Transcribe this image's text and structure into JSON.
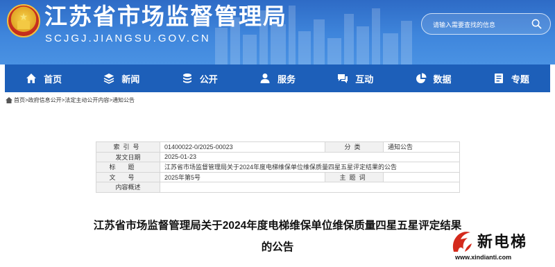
{
  "header": {
    "site_title": "江苏省市场监督管理局",
    "site_url": "SCJGJ.JIANGSU.GOV.CN",
    "search_placeholder": "请输入需要查找的信息"
  },
  "nav": {
    "items": [
      {
        "label": "首页",
        "icon": "home-icon"
      },
      {
        "label": "新闻",
        "icon": "news-icon"
      },
      {
        "label": "公开",
        "icon": "disclosure-icon"
      },
      {
        "label": "服务",
        "icon": "service-icon"
      },
      {
        "label": "互动",
        "icon": "interaction-icon"
      },
      {
        "label": "数据",
        "icon": "data-icon"
      },
      {
        "label": "专题",
        "icon": "topic-icon"
      }
    ]
  },
  "breadcrumb": {
    "items": [
      "首页",
      "政府信息公开",
      "法定主动公开内容",
      "通知公告"
    ],
    "separator": ">"
  },
  "info_table": {
    "index_label": "索引号",
    "index_value": "01400022-0/2025-00023",
    "category_label": "分类",
    "category_value": "通知公告",
    "date_label": "发文日期",
    "date_value": "2025-01-23",
    "title_label": "标题",
    "title_value": "江苏省市场监督管理局关于2024年度电梯维保单位维保质量四星五星评定结果的公告",
    "doc_no_label": "文号",
    "doc_no_value": "2025年第5号",
    "subject_label": "主题词",
    "subject_value": "",
    "summary_label": "内容概述",
    "summary_value": ""
  },
  "article": {
    "title_line1": "江苏省市场监督管理局关于2024年度电梯维保单位维保质量四星五星评定结果",
    "title_line2": "的公告"
  },
  "watermark": {
    "name": "新电梯",
    "url": "www.xindianti.com"
  },
  "colors": {
    "header_blue": "#3f86dc",
    "nav_blue": "#1d5fb9",
    "label_bg": "#f1f1f1"
  }
}
